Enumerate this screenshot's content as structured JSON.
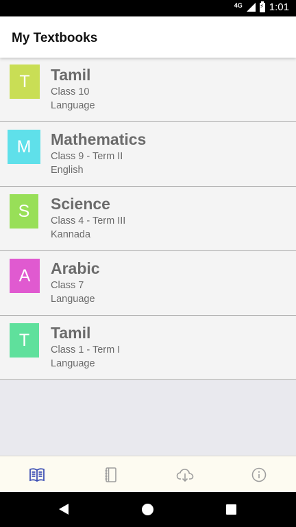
{
  "status_bar": {
    "network": "4G",
    "time": "1:01"
  },
  "app_bar": {
    "title": "My Textbooks"
  },
  "textbooks": [
    {
      "letter": "T",
      "name": "Tamil",
      "class": "Class 10",
      "medium": "Language",
      "color": "#c9de55"
    },
    {
      "letter": "M",
      "name": "Mathematics",
      "class": "Class 9 - Term II",
      "medium": "English",
      "color": "#5fe0ea"
    },
    {
      "letter": "S",
      "name": "Science",
      "class": "Class 4 - Term III",
      "medium": "Kannada",
      "color": "#98df58"
    },
    {
      "letter": "A",
      "name": "Arabic",
      "class": "Class 7",
      "medium": "Language",
      "color": "#e05ad0"
    },
    {
      "letter": "T",
      "name": "Tamil",
      "class": "Class 1 - Term I",
      "medium": "Language",
      "color": "#5fe09c"
    }
  ],
  "bottom_nav": [
    {
      "icon": "book-open-icon",
      "active": true
    },
    {
      "icon": "notebook-icon",
      "active": false
    },
    {
      "icon": "cloud-download-icon",
      "active": false
    },
    {
      "icon": "info-icon",
      "active": false
    }
  ],
  "colors": {
    "accent": "#3f51b5",
    "nav_inactive": "#9e9e9e",
    "nav_background": "#fdfbf1"
  }
}
